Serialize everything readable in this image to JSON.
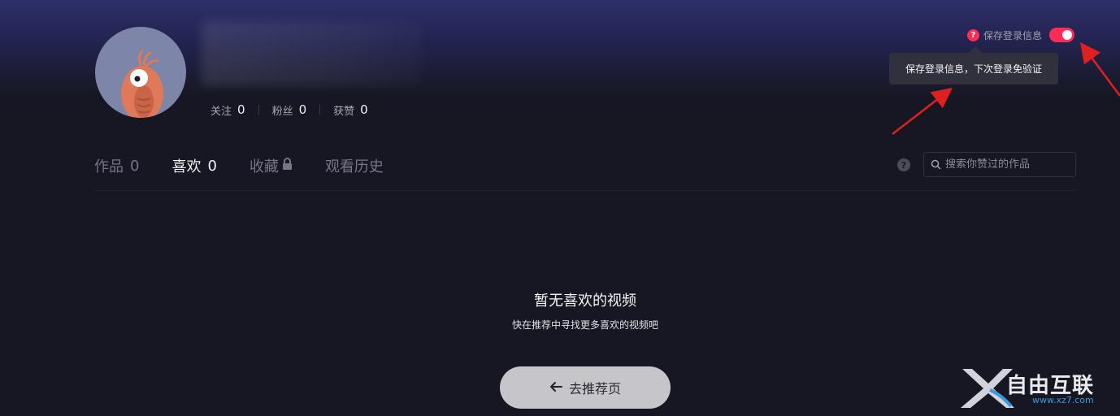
{
  "profile": {
    "stats": [
      {
        "label": "关注",
        "value": "0"
      },
      {
        "label": "粉丝",
        "value": "0"
      },
      {
        "label": "获赞",
        "value": "0"
      }
    ]
  },
  "save_login": {
    "label": "保存登录信息",
    "enabled": true,
    "tooltip": "保存登录信息，下次登录免验证"
  },
  "tabs": [
    {
      "label": "作品",
      "count": "0",
      "active": false
    },
    {
      "label": "喜欢",
      "count": "0",
      "active": true
    },
    {
      "label": "收藏",
      "count": "",
      "active": false,
      "icon": "lock-icon"
    },
    {
      "label": "观看历史",
      "count": "",
      "active": false
    }
  ],
  "search": {
    "placeholder": "搜索你赞过的作品"
  },
  "empty_state": {
    "title": "暂无喜欢的视频",
    "subtitle": "快在推荐中寻找更多喜欢的视频吧",
    "button_label": "去推荐页"
  },
  "watermark": {
    "text": "自由互联",
    "url": "www.xz7.com"
  },
  "colors": {
    "accent": "#fe2c55",
    "background": "#161722",
    "annotation_arrow": "#e02020"
  }
}
